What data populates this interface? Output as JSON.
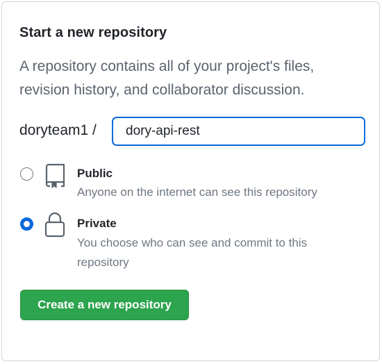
{
  "form": {
    "title": "Start a new repository",
    "description": "A repository contains all of your project's files, revision history, and collaborator discussion.",
    "owner_label": "doryteam1 /",
    "repo_name_value": "dory-api-rest"
  },
  "visibility": {
    "public": {
      "label": "Public",
      "hint": "Anyone on the internet can see this repository",
      "icon": "repo-icon",
      "selected": false
    },
    "private": {
      "label": "Private",
      "hint": "You choose who can see and commit to this repository",
      "icon": "lock-icon",
      "selected": true
    }
  },
  "actions": {
    "create_label": "Create a new repository"
  },
  "colors": {
    "accent": "#0969da",
    "primary_button": "#2da44e",
    "muted_text": "#6e7781"
  }
}
